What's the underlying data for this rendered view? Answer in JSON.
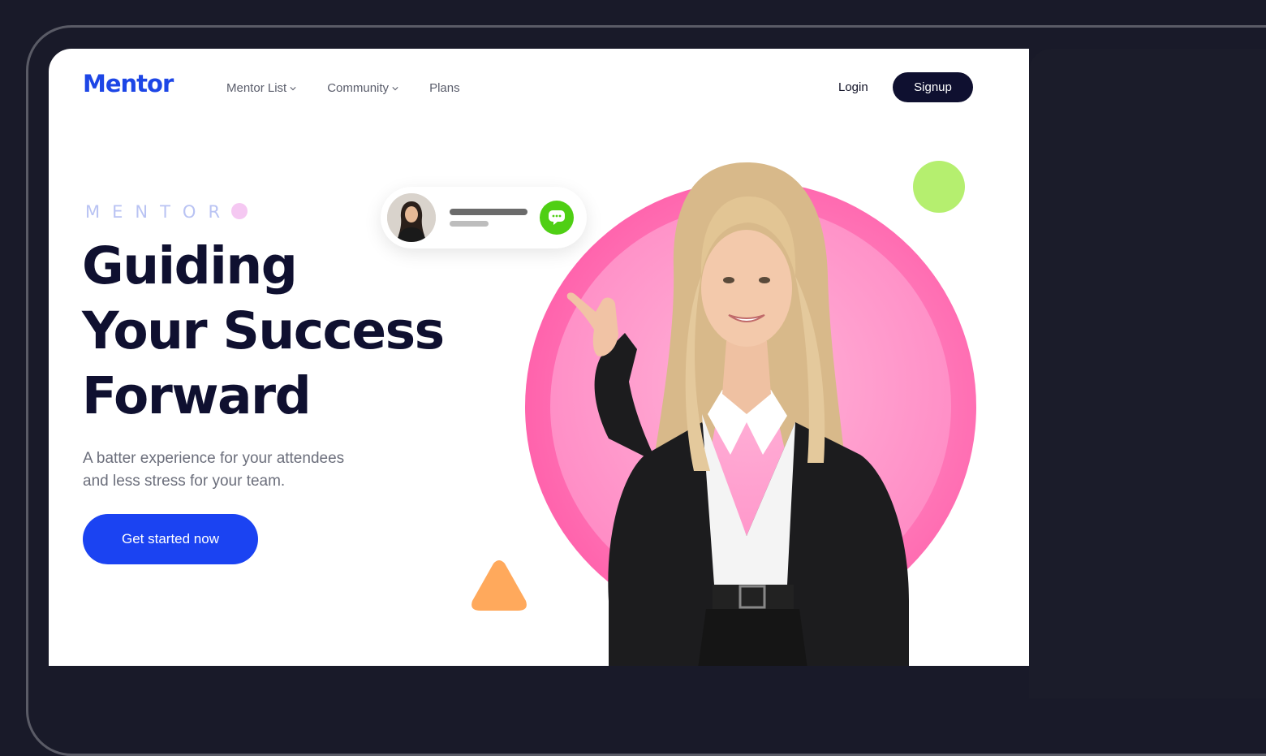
{
  "brand": {
    "logo": "Mentor",
    "accent": "#1d46e6"
  },
  "nav": {
    "items": [
      {
        "label": "Mentor List"
      },
      {
        "label": "Community"
      },
      {
        "label": "Plans"
      }
    ],
    "login_label": "Login",
    "signup_label": "Signup"
  },
  "hero": {
    "eyebrow": "MENTOR",
    "headline": [
      "Guiding",
      "Your Success",
      "Forward"
    ],
    "subtitle_lines": [
      "A batter experience for your attendees",
      "and less stress for your team."
    ],
    "cta_label": "Get started now"
  },
  "colors": {
    "dark_navy": "#0f1030",
    "cta_blue": "#1b43f2",
    "pink": "#ff5ea8",
    "lime": "#b5ef6f",
    "orange": "#ffa95c",
    "chat_green": "#4fcf14"
  },
  "icons": [
    "chevron-down-icon",
    "chat-bubble-icon"
  ]
}
